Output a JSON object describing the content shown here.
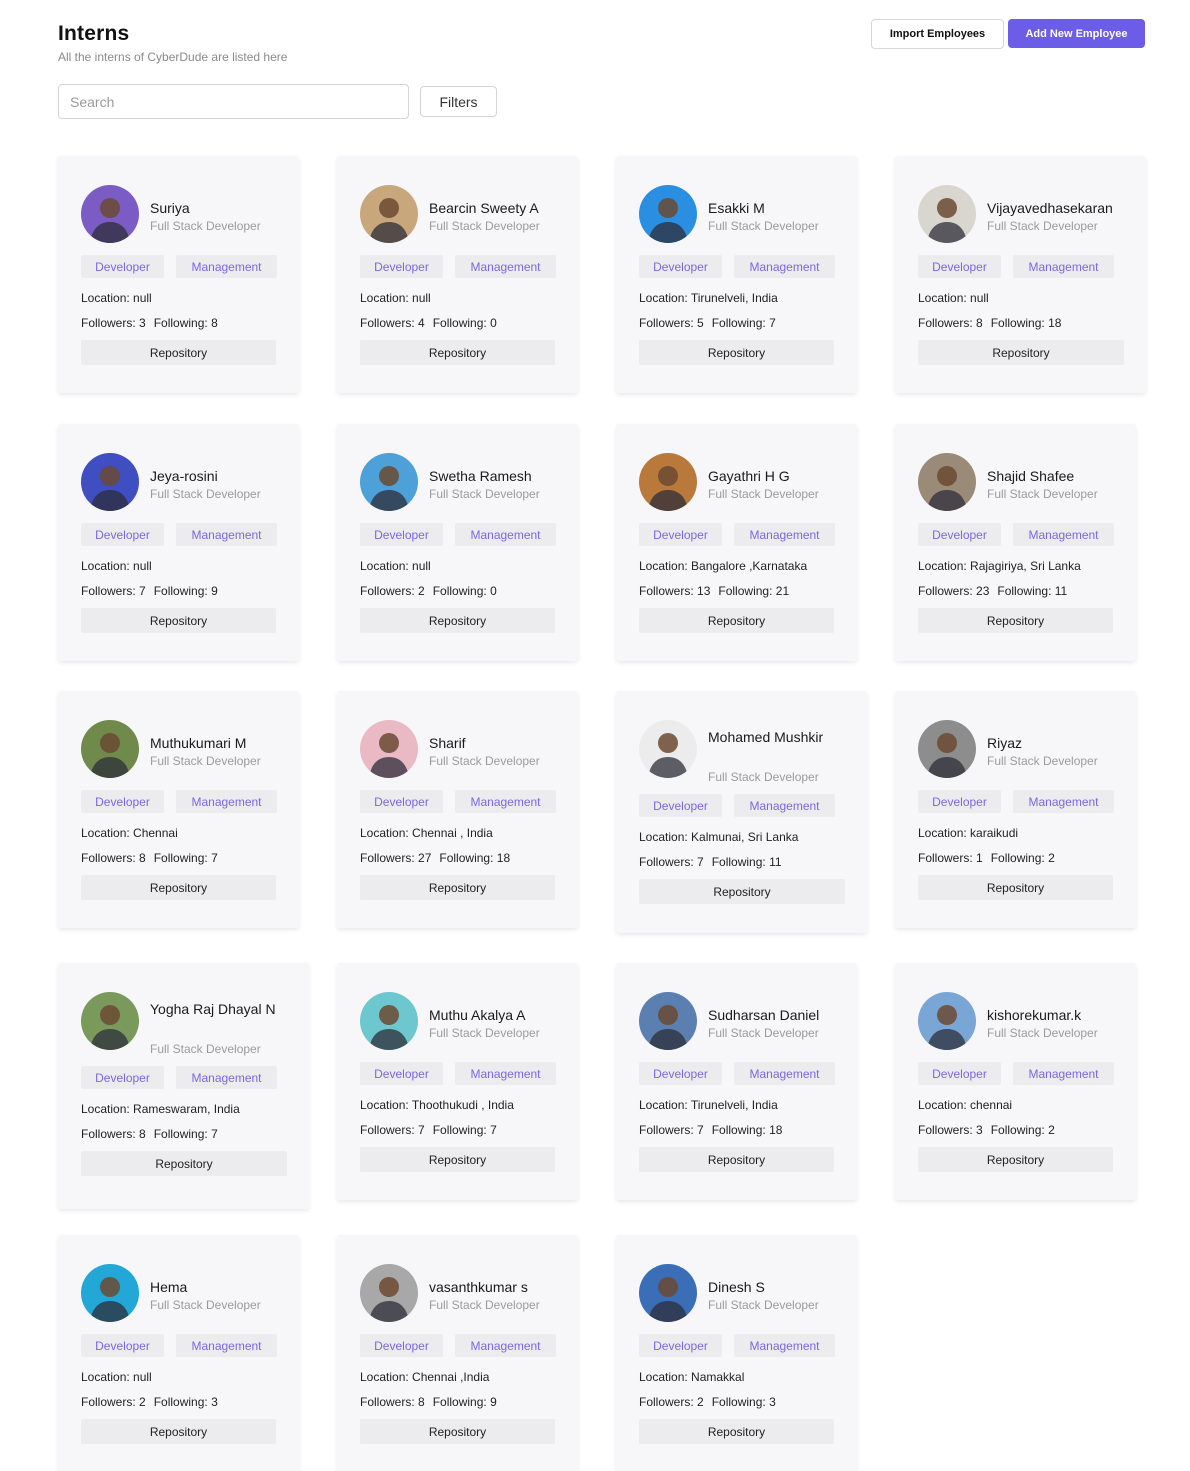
{
  "page": {
    "title": "Interns",
    "subtitle": "All the interns of CyberDude are listed here"
  },
  "toolbar": {
    "import_label": "Import Employees",
    "add_label": "Add New Employee",
    "filters_label": "Filters"
  },
  "search": {
    "placeholder": "Search",
    "value": ""
  },
  "labels": {
    "developer_tag": "Developer",
    "management_tag": "Management",
    "location_prefix": "Location:",
    "followers_prefix": "Followers:",
    "following_prefix": "Following:",
    "repository_button": "Repository"
  },
  "colors": {
    "accent": "#6c5ce7",
    "tag_text": "#7b68e0",
    "card_bg": "#f7f7f9"
  },
  "interns": [
    {
      "name": "Suriya",
      "role": "Full Stack Developer",
      "location": "null",
      "followers": "3",
      "following": "8",
      "avatar_color": "#7b5cc4"
    },
    {
      "name": "Bearcin Sweety A",
      "role": "Full Stack Developer",
      "location": "null",
      "followers": "4",
      "following": "0",
      "avatar_color": "#c9a77c"
    },
    {
      "name": "Esakki M",
      "role": "Full Stack Developer",
      "location": "Tirunelveli, India",
      "followers": "5",
      "following": "7",
      "avatar_color": "#2a8fe0"
    },
    {
      "name": "Vijayavedhasekaran",
      "role": "Full Stack Developer",
      "location": "null",
      "followers": "8",
      "following": "18",
      "avatar_color": "#d9d5cf"
    },
    {
      "name": "Jeya-rosini",
      "role": "Full Stack Developer",
      "location": "null",
      "followers": "7",
      "following": "9",
      "avatar_color": "#3f4ec0"
    },
    {
      "name": "Swetha Ramesh",
      "role": "Full Stack Developer",
      "location": "null",
      "followers": "2",
      "following": "0",
      "avatar_color": "#4da0d8"
    },
    {
      "name": "Gayathri H G",
      "role": "Full Stack Developer",
      "location": "Bangalore ,Karnataka",
      "followers": "13",
      "following": "21",
      "avatar_color": "#b8793a"
    },
    {
      "name": "Shajid Shafee",
      "role": "Full Stack Developer",
      "location": "Rajagiriya, Sri Lanka",
      "followers": "23",
      "following": "11",
      "avatar_color": "#9a8a78"
    },
    {
      "name": "Muthukumari M",
      "role": "Full Stack Developer",
      "location": "Chennai",
      "followers": "8",
      "following": "7",
      "avatar_color": "#6f8a4a"
    },
    {
      "name": "Sharif",
      "role": "Full Stack Developer",
      "location": "Chennai , India",
      "followers": "27",
      "following": "18",
      "avatar_color": "#e9b9c4"
    },
    {
      "name": "Mohamed Mushkir",
      "role": "Full Stack Developer",
      "location": "Kalmunai, Sri Lanka",
      "followers": "7",
      "following": "11",
      "avatar_color": "#ececec"
    },
    {
      "name": "Riyaz",
      "role": "Full Stack Developer",
      "location": "karaikudi",
      "followers": "1",
      "following": "2",
      "avatar_color": "#8d8d8d"
    },
    {
      "name": "Yogha Raj Dhayal N",
      "role": "Full Stack Developer",
      "location": "Rameswaram, India",
      "followers": "8",
      "following": "7",
      "avatar_color": "#7a9a5c"
    },
    {
      "name": "Muthu Akalya A",
      "role": "Full Stack Developer",
      "location": "Thoothukudi , India",
      "followers": "7",
      "following": "7",
      "avatar_color": "#6cc7cf"
    },
    {
      "name": "Sudharsan Daniel",
      "role": "Full Stack Developer",
      "location": "Tirunelveli, India",
      "followers": "7",
      "following": "18",
      "avatar_color": "#5a7fb0"
    },
    {
      "name": "kishorekumar.k",
      "role": "Full Stack Developer",
      "location": "chennai",
      "followers": "3",
      "following": "2",
      "avatar_color": "#7aa6d6"
    },
    {
      "name": "Hema",
      "role": "Full Stack Developer",
      "location": "null",
      "followers": "2",
      "following": "3",
      "avatar_color": "#22a7d6"
    },
    {
      "name": "vasanthkumar s",
      "role": "Full Stack Developer",
      "location": "Chennai ,India",
      "followers": "8",
      "following": "9",
      "avatar_color": "#a8a8a8"
    },
    {
      "name": "Dinesh S",
      "role": "Full Stack Developer",
      "location": "Namakkal",
      "followers": "2",
      "following": "3",
      "avatar_color": "#3a6fb8"
    }
  ]
}
